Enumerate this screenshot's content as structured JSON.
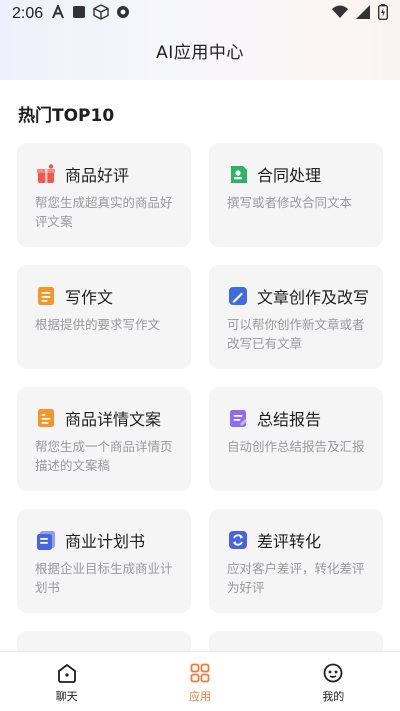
{
  "status_bar": {
    "time": "2:06"
  },
  "header": {
    "title": "AI应用中心"
  },
  "section": {
    "title": "热门TOP10"
  },
  "cards": [
    {
      "title": "商品好评",
      "desc": "帮您生成超真实的商品好评文案",
      "icon": "gift-icon",
      "color": "#f2564d"
    },
    {
      "title": "合同处理",
      "desc": "撰写或者修改合同文本",
      "icon": "contract-icon",
      "color": "#2fb36a"
    },
    {
      "title": "写作文",
      "desc": "根据提供的要求写作文",
      "icon": "essay-icon",
      "color": "#f5962c"
    },
    {
      "title": "文章创作及改写",
      "desc": "可以帮你创作新文章或者改写已有文章",
      "icon": "pen-icon",
      "color": "#3d6be0"
    },
    {
      "title": "商品详情文案",
      "desc": "帮您生成一个商品详情页描述的文案稿",
      "icon": "detail-doc-icon",
      "color": "#f5962c"
    },
    {
      "title": "总结报告",
      "desc": "自动创作总结报告及汇报",
      "icon": "report-icon",
      "color": "#8c6cf0"
    },
    {
      "title": "商业计划书",
      "desc": "根据企业目标生成商业计划书",
      "icon": "plan-icon",
      "color": "#4a63e0"
    },
    {
      "title": "差评转化",
      "desc": "应对客户差评，转化差评为好评",
      "icon": "convert-icon",
      "color": "#4a63e0"
    }
  ],
  "tabs": [
    {
      "label": "聊天",
      "icon": "chat-home-icon",
      "active": false
    },
    {
      "label": "应用",
      "icon": "apps-grid-icon",
      "active": true
    },
    {
      "label": "我的",
      "icon": "profile-face-icon",
      "active": false
    }
  ],
  "accent_color": "#f07a3a"
}
